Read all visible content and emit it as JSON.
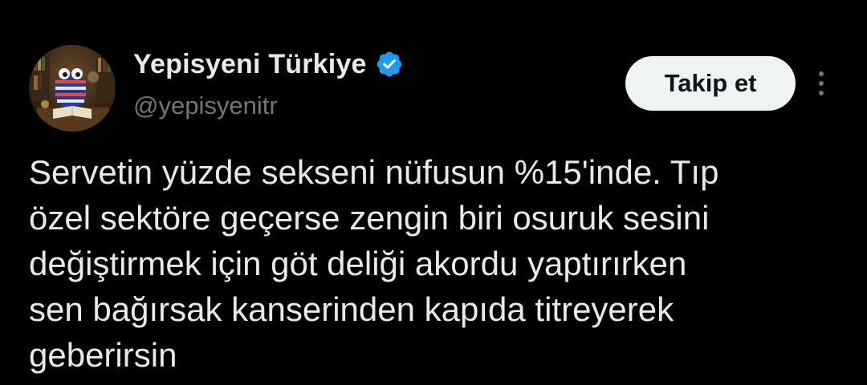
{
  "author": {
    "display_name": "Yepisyeni Türkiye",
    "handle": "@yepisyenitr",
    "verified": true,
    "verified_color": "#1d9bf0"
  },
  "actions": {
    "follow_label": "Takip et",
    "more_icon": "more-vertical-icon"
  },
  "tweet": {
    "lines": [
      "Servetin yüzde sekseni nüfusun %15'inde. Tıp",
      "özel sektöre geçerse zengin biri osuruk sesini",
      "değiştirmek için göt deliği akordu yaptırırken",
      "sen bağırsak kanserinden kapıda titreyerek",
      "geberirsin"
    ]
  },
  "colors": {
    "background": "#000000",
    "text_primary": "#e7e9ea",
    "text_secondary": "#71767b",
    "button_bg": "#eff3f4",
    "button_text": "#0f1419"
  }
}
